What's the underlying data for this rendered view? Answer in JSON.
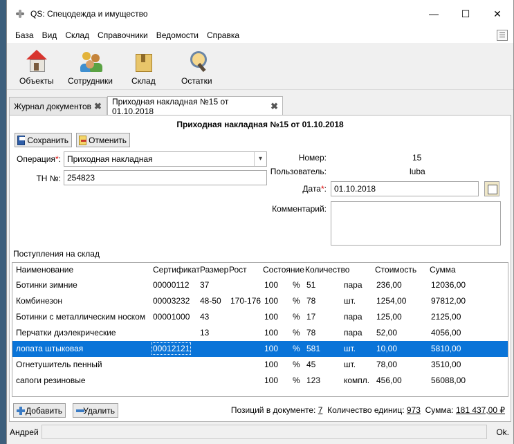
{
  "window": {
    "title": "QS: Спецодежда и имущество",
    "min": "—",
    "max": "☐",
    "close": "✕"
  },
  "menu": [
    "База",
    "Вид",
    "Склад",
    "Справочники",
    "Ведомости",
    "Справка"
  ],
  "toolbar": [
    {
      "label": "Объекты",
      "icon": "house-icon"
    },
    {
      "label": "Сотрудники",
      "icon": "people-icon"
    },
    {
      "label": "Склад",
      "icon": "box-icon"
    },
    {
      "label": "Остатки",
      "icon": "magnifier-icon"
    }
  ],
  "tabs": [
    {
      "label": "Журнал документов",
      "close": "✖",
      "active": false
    },
    {
      "label": "Приходная накладная №15 от 01.10.2018",
      "close": "✖",
      "active": true
    }
  ],
  "doc": {
    "title": "Приходная накладная №15 от 01.10.2018",
    "save_label": "Сохранить",
    "cancel_label": "Отменить",
    "operation_label": "Операция",
    "operation_value": "Приходная накладная",
    "tn_label": "ТН №:",
    "tn_value": "254823",
    "number_label": "Номер:",
    "number_value": "15",
    "user_label": "Пользователь:",
    "user_value": "luba",
    "date_label": "Дата",
    "date_value": "01.10.2018",
    "comment_label": "Комментарий:",
    "req_mark": "*",
    "colon": ":",
    "combo_arrow": "▾"
  },
  "grid": {
    "section_label": "Поступления на склад",
    "columns": [
      "Наименование",
      "Сертификат",
      "Размер",
      "Рост",
      "Состояние",
      "Количество",
      "Стоимость",
      "Сумма"
    ],
    "rows": [
      {
        "name": "Ботинки зимние",
        "cert": "00000112",
        "size": "37",
        "height": "",
        "state": "100",
        "pct": "%",
        "qty": "51",
        "unit": "пара",
        "price": "236,00",
        "sum": "12036,00"
      },
      {
        "name": "Комбинезон",
        "cert": "00003232",
        "size": "48-50",
        "height": "170-176",
        "state": "100",
        "pct": "%",
        "qty": "78",
        "unit": "шт.",
        "price": "1254,00",
        "sum": "97812,00"
      },
      {
        "name": "Ботинки с металлическим носком",
        "cert": "00001000",
        "size": "43",
        "height": "",
        "state": "100",
        "pct": "%",
        "qty": "17",
        "unit": "пара",
        "price": "125,00",
        "sum": "2125,00"
      },
      {
        "name": "Перчатки диэлекрические",
        "cert": "",
        "size": "13",
        "height": "",
        "state": "100",
        "pct": "%",
        "qty": "78",
        "unit": "пара",
        "price": "52,00",
        "sum": "4056,00"
      },
      {
        "name": "лопата штыковая",
        "cert": "00012121",
        "size": "",
        "height": "",
        "state": "100",
        "pct": "%",
        "qty": "581",
        "unit": "шт.",
        "price": "10,00",
        "sum": "5810,00",
        "selected": true
      },
      {
        "name": "Огнетушитель пенный",
        "cert": "",
        "size": "",
        "height": "",
        "state": "100",
        "pct": "%",
        "qty": "45",
        "unit": "шт.",
        "price": "78,00",
        "sum": "3510,00"
      },
      {
        "name": "сапоги резиновые",
        "cert": "",
        "size": "",
        "height": "",
        "state": "100",
        "pct": "%",
        "qty": "123",
        "unit": "компл.",
        "price": "456,00",
        "sum": "56088,00"
      }
    ]
  },
  "footer": {
    "add_label": "Добавить",
    "delete_label": "Удалить",
    "positions_label": "Позиций в документе:",
    "positions_value": "7",
    "units_label": "Количество единиц:",
    "units_value": "973",
    "total_label": "Сумма:",
    "total_value": "181 437,00 ₽"
  },
  "status": {
    "user": "Андрей",
    "state": "Ok."
  }
}
